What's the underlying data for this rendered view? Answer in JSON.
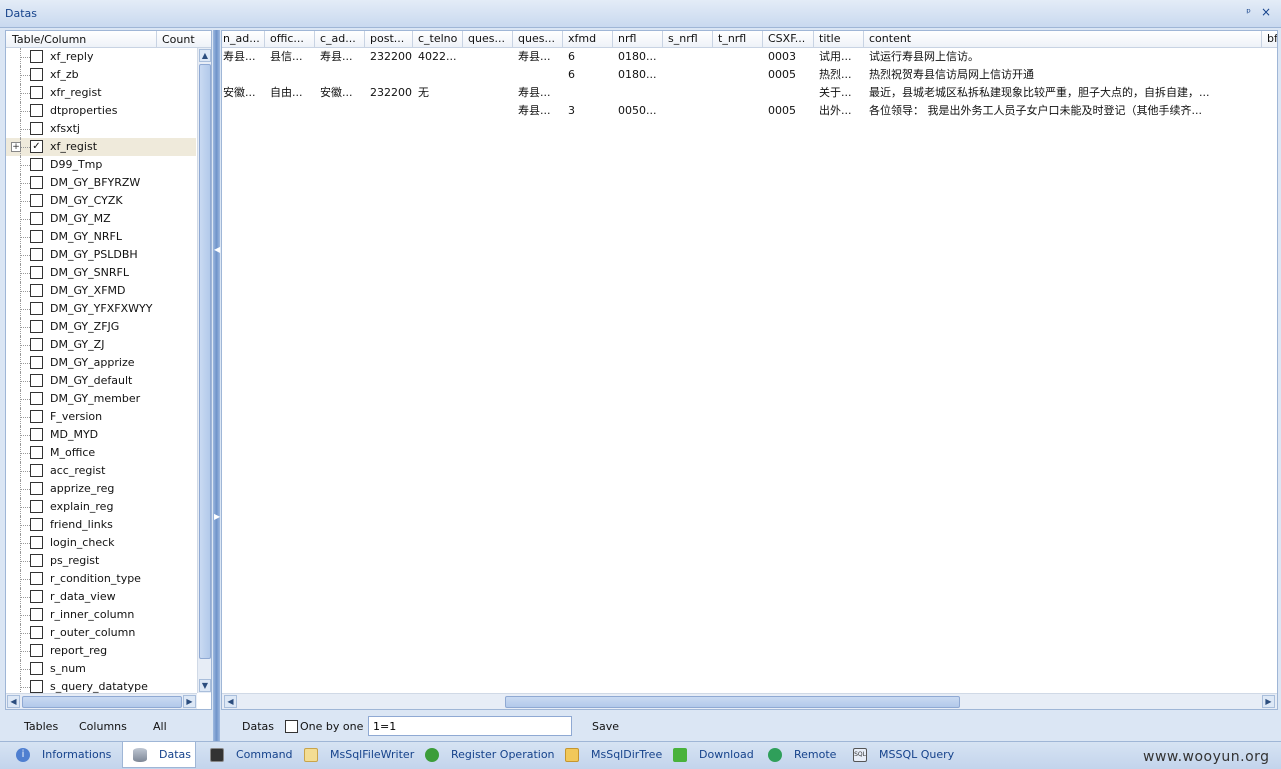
{
  "window": {
    "title": "Datas",
    "pin_glyph": "ᵖ",
    "close_glyph": "×"
  },
  "tree": {
    "headers": {
      "name": "Table/Column",
      "count": "Count"
    },
    "items": [
      {
        "label": "xf_reply",
        "checked": false,
        "expandable": false,
        "selected": false
      },
      {
        "label": "xf_zb",
        "checked": false,
        "expandable": false,
        "selected": false
      },
      {
        "label": "xfr_regist",
        "checked": false,
        "expandable": false,
        "selected": false
      },
      {
        "label": "dtproperties",
        "checked": false,
        "expandable": false,
        "selected": false
      },
      {
        "label": "xfsxtj",
        "checked": false,
        "expandable": false,
        "selected": false
      },
      {
        "label": "xf_regist",
        "checked": true,
        "expandable": true,
        "selected": true
      },
      {
        "label": "D99_Tmp",
        "checked": false,
        "expandable": false,
        "selected": false
      },
      {
        "label": "DM_GY_BFYRZW",
        "checked": false,
        "expandable": false,
        "selected": false
      },
      {
        "label": "DM_GY_CYZK",
        "checked": false,
        "expandable": false,
        "selected": false
      },
      {
        "label": "DM_GY_MZ",
        "checked": false,
        "expandable": false,
        "selected": false
      },
      {
        "label": "DM_GY_NRFL",
        "checked": false,
        "expandable": false,
        "selected": false
      },
      {
        "label": "DM_GY_PSLDBH",
        "checked": false,
        "expandable": false,
        "selected": false
      },
      {
        "label": "DM_GY_SNRFL",
        "checked": false,
        "expandable": false,
        "selected": false
      },
      {
        "label": "DM_GY_XFMD",
        "checked": false,
        "expandable": false,
        "selected": false
      },
      {
        "label": "DM_GY_YFXFXWYY",
        "checked": false,
        "expandable": false,
        "selected": false
      },
      {
        "label": "DM_GY_ZFJG",
        "checked": false,
        "expandable": false,
        "selected": false
      },
      {
        "label": "DM_GY_ZJ",
        "checked": false,
        "expandable": false,
        "selected": false
      },
      {
        "label": "DM_GY_apprize",
        "checked": false,
        "expandable": false,
        "selected": false
      },
      {
        "label": "DM_GY_default",
        "checked": false,
        "expandable": false,
        "selected": false
      },
      {
        "label": "DM_GY_member",
        "checked": false,
        "expandable": false,
        "selected": false
      },
      {
        "label": "F_version",
        "checked": false,
        "expandable": false,
        "selected": false
      },
      {
        "label": "MD_MYD",
        "checked": false,
        "expandable": false,
        "selected": false
      },
      {
        "label": "M_office",
        "checked": false,
        "expandable": false,
        "selected": false
      },
      {
        "label": "acc_regist",
        "checked": false,
        "expandable": false,
        "selected": false
      },
      {
        "label": "apprize_reg",
        "checked": false,
        "expandable": false,
        "selected": false
      },
      {
        "label": "explain_reg",
        "checked": false,
        "expandable": false,
        "selected": false
      },
      {
        "label": "friend_links",
        "checked": false,
        "expandable": false,
        "selected": false
      },
      {
        "label": "login_check",
        "checked": false,
        "expandable": false,
        "selected": false
      },
      {
        "label": "ps_regist",
        "checked": false,
        "expandable": false,
        "selected": false
      },
      {
        "label": "r_condition_type",
        "checked": false,
        "expandable": false,
        "selected": false
      },
      {
        "label": "r_data_view",
        "checked": false,
        "expandable": false,
        "selected": false
      },
      {
        "label": "r_inner_column",
        "checked": false,
        "expandable": false,
        "selected": false
      },
      {
        "label": "r_outer_column",
        "checked": false,
        "expandable": false,
        "selected": false
      },
      {
        "label": "report_reg",
        "checked": false,
        "expandable": false,
        "selected": false
      },
      {
        "label": "s_num",
        "checked": false,
        "expandable": false,
        "selected": false
      },
      {
        "label": "s_query_datatype",
        "checked": false,
        "expandable": false,
        "selected": false
      }
    ]
  },
  "left_bottom": {
    "tables": "Tables",
    "columns": "Columns",
    "all": "All"
  },
  "grid": {
    "columns": [
      "n_ad...",
      "offic...",
      "c_ad...",
      "post...",
      "c_telno",
      "ques...",
      "ques...",
      "xfmd",
      "nrfl",
      "s_nrfl",
      "t_nrfl",
      "CSXF...",
      "title",
      "content",
      "bf"
    ],
    "rows": [
      [
        "寿县...",
        "县信...",
        "寿县...",
        "232200",
        "4022...",
        "",
        "寿县...",
        "6",
        "0180...",
        "",
        "",
        "0003",
        "试用...",
        "试运行寿县网上信访。",
        ""
      ],
      [
        "",
        "",
        "",
        "",
        "",
        "",
        "",
        "6",
        "0180...",
        "",
        "",
        "0005",
        "热烈...",
        "热烈祝贺寿县信访局网上信访开通",
        ""
      ],
      [
        "安徽...",
        "自由...",
        "安徽...",
        "232200",
        "无",
        "",
        "寿县...",
        "",
        "",
        "",
        "",
        "",
        "关于...",
        "最近，县城老城区私拆私建现象比较严重，胆子大点的，自拆自建，...",
        ""
      ],
      [
        "",
        "",
        "",
        "",
        "",
        "",
        "寿县...",
        "3",
        "0050...",
        "",
        "",
        "0005",
        "出外...",
        "各位领导：  我是出外务工人员子女户口未能及时登记（其他手续齐...",
        ""
      ]
    ]
  },
  "query_bar": {
    "datas": "Datas",
    "one_by_one": "One by one",
    "one_by_one_checked": false,
    "where_value": "1=1",
    "save": "Save"
  },
  "tabs": [
    {
      "label": "Informations",
      "icon": "info-icon",
      "active": false
    },
    {
      "label": "Datas",
      "icon": "database-icon",
      "active": true
    },
    {
      "label": "Command",
      "icon": "command-icon",
      "active": false
    },
    {
      "label": "MsSqlFileWriter",
      "icon": "file-writer-icon",
      "active": false
    },
    {
      "label": "Register Operation",
      "icon": "register-icon",
      "active": false
    },
    {
      "label": "MsSqlDirTree",
      "icon": "folder-icon",
      "active": false
    },
    {
      "label": "Download",
      "icon": "download-icon",
      "active": false
    },
    {
      "label": "Remote",
      "icon": "remote-icon",
      "active": false
    },
    {
      "label": "MSSQL Query",
      "icon": "sql-icon",
      "active": false
    }
  ],
  "watermark": "www.wooyun.org",
  "colors": {
    "accent": "#15428b",
    "selected_row": "#efeadb",
    "frame": "#dbe6f4"
  }
}
